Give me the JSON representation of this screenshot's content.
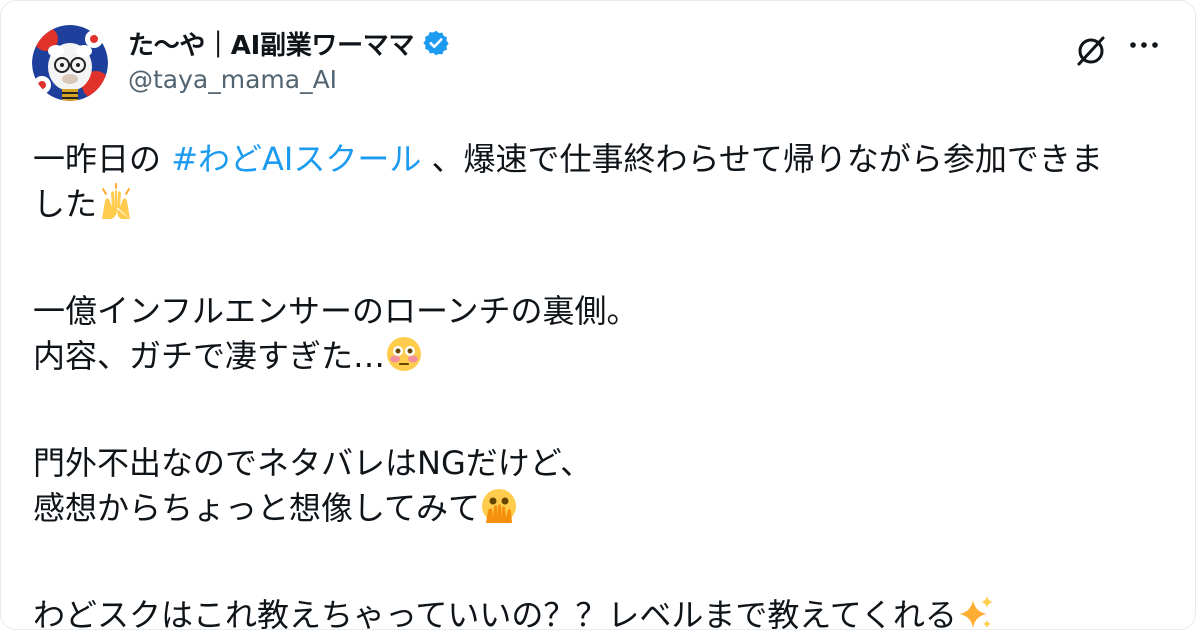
{
  "author": {
    "display_name": "た〜や｜AI副業ワーママ",
    "handle": "@taya_mama_AI",
    "verified": true
  },
  "header_icons": {
    "logo": "x-logo-icon",
    "more": "more-options-icon"
  },
  "tweet": {
    "line1_before": "一昨日の ",
    "hashtag": "#わどAIスクール",
    "line1_after": " 、爆速で仕事終わらせて帰りながら参加できま",
    "line2": "した",
    "line3": "一億インフルエンサーのローンチの裏側。",
    "line4": "内容、ガチで凄すぎた…",
    "line5": "門外不出なのでネタバレはNGだけど、",
    "line6": "感想からちょっと想像してみて",
    "line7": "わどスクはこれ教えちゃっていいの？？レベルまで教えてくれる"
  },
  "emojis": {
    "raised_hands": "raising-hands-emoji",
    "flushed": "flushed-face-emoji",
    "peeking": "face-with-open-eyes-and-hand-over-mouth-emoji",
    "sparkles": "sparkles-emoji"
  },
  "colors": {
    "link": "#1d9bf0",
    "text": "#0f1419",
    "muted": "#536471",
    "verified": "#1d9bf0"
  }
}
